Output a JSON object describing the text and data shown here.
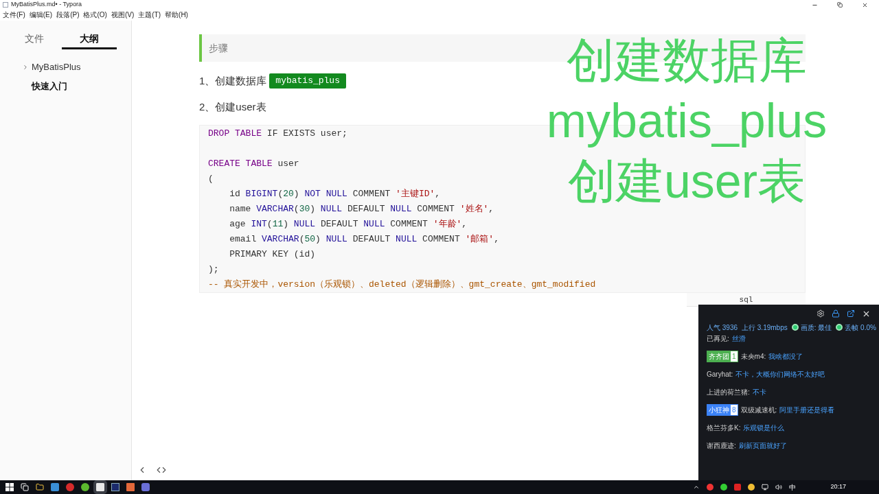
{
  "window": {
    "title": "MyBatisPlus.md• - Typora"
  },
  "menu": [
    "文件(F)",
    "编辑(E)",
    "段落(P)",
    "格式(O)",
    "视图(V)",
    "主题(T)",
    "帮助(H)"
  ],
  "sidebar": {
    "tabs": [
      {
        "label": "文件",
        "selected": false
      },
      {
        "label": "大纲",
        "selected": true
      }
    ],
    "items": [
      {
        "label": "MyBatisPlus",
        "kind": "group",
        "expanded": false,
        "selected": false
      },
      {
        "label": "快速入门",
        "kind": "leaf",
        "selected": true
      }
    ]
  },
  "document": {
    "quote": "步骤",
    "steps": [
      {
        "text": "1、创建数据库",
        "code": "mybatis_plus"
      },
      {
        "text": "2、创建user表"
      }
    ],
    "code_block": {
      "language": "sql",
      "lines": [
        {
          "kind": "code",
          "tokens": [
            {
              "text": "DROP ",
              "kind": "keyword"
            },
            {
              "text": "TABLE",
              "kind": "keyword"
            },
            {
              "text": " IF EXISTS user;",
              "kind": "plain"
            }
          ]
        },
        {
          "kind": "blank"
        },
        {
          "kind": "code",
          "tokens": [
            {
              "text": "CREATE ",
              "kind": "keyword"
            },
            {
              "text": "TABLE",
              "kind": "keyword"
            },
            {
              "text": " user",
              "kind": "plain"
            }
          ]
        },
        {
          "kind": "code",
          "tokens": [
            {
              "text": "(",
              "kind": "plain"
            }
          ]
        },
        {
          "kind": "code",
          "tokens": [
            {
              "text": "    id ",
              "kind": "plain"
            },
            {
              "text": "BIGINT",
              "kind": "builtin"
            },
            {
              "text": "(",
              "kind": "plain"
            },
            {
              "text": "20",
              "kind": "number"
            },
            {
              "text": ") ",
              "kind": "plain"
            },
            {
              "text": "NOT NULL",
              "kind": "builtin"
            },
            {
              "text": " COMMENT ",
              "kind": "plain"
            },
            {
              "text": "'主键ID'",
              "kind": "string"
            },
            {
              "text": ",",
              "kind": "plain"
            }
          ]
        },
        {
          "kind": "code",
          "tokens": [
            {
              "text": "    name ",
              "kind": "plain"
            },
            {
              "text": "VARCHAR",
              "kind": "builtin"
            },
            {
              "text": "(",
              "kind": "plain"
            },
            {
              "text": "30",
              "kind": "number"
            },
            {
              "text": ") ",
              "kind": "plain"
            },
            {
              "text": "NULL",
              "kind": "builtin"
            },
            {
              "text": " DEFAULT ",
              "kind": "plain"
            },
            {
              "text": "NULL",
              "kind": "builtin"
            },
            {
              "text": " COMMENT ",
              "kind": "plain"
            },
            {
              "text": "'姓名'",
              "kind": "string"
            },
            {
              "text": ",",
              "kind": "plain"
            }
          ]
        },
        {
          "kind": "code",
          "tokens": [
            {
              "text": "    age ",
              "kind": "plain"
            },
            {
              "text": "INT",
              "kind": "builtin"
            },
            {
              "text": "(",
              "kind": "plain"
            },
            {
              "text": "11",
              "kind": "number"
            },
            {
              "text": ") ",
              "kind": "plain"
            },
            {
              "text": "NULL",
              "kind": "builtin"
            },
            {
              "text": " DEFAULT ",
              "kind": "plain"
            },
            {
              "text": "NULL",
              "kind": "builtin"
            },
            {
              "text": " COMMENT ",
              "kind": "plain"
            },
            {
              "text": "'年龄'",
              "kind": "string"
            },
            {
              "text": ",",
              "kind": "plain"
            }
          ]
        },
        {
          "kind": "code",
          "tokens": [
            {
              "text": "    email ",
              "kind": "plain"
            },
            {
              "text": "VARCHAR",
              "kind": "builtin"
            },
            {
              "text": "(",
              "kind": "plain"
            },
            {
              "text": "50",
              "kind": "number"
            },
            {
              "text": ") ",
              "kind": "plain"
            },
            {
              "text": "NULL",
              "kind": "builtin"
            },
            {
              "text": " DEFAULT ",
              "kind": "plain"
            },
            {
              "text": "NULL",
              "kind": "builtin"
            },
            {
              "text": " COMMENT ",
              "kind": "plain"
            },
            {
              "text": "'邮箱'",
              "kind": "string"
            },
            {
              "text": ",",
              "kind": "plain"
            }
          ]
        },
        {
          "kind": "code",
          "tokens": [
            {
              "text": "    PRIMARY KEY (id)",
              "kind": "plain"
            }
          ]
        },
        {
          "kind": "code",
          "tokens": [
            {
              "text": ");",
              "kind": "plain"
            }
          ]
        },
        {
          "kind": "code",
          "tokens": [
            {
              "text": "-- 真实开发中，version（乐观锁）、deleted（逻辑删除）、gmt_create、gmt_modified",
              "kind": "comment"
            }
          ]
        }
      ]
    }
  },
  "caption": [
    "创建数据库",
    "mybatis_plus",
    "创建user表"
  ],
  "live_panel": {
    "stats": [
      {
        "kind": "text",
        "label": "人气",
        "value": "3936"
      },
      {
        "kind": "text",
        "label": "上行",
        "value": "3.19mbps"
      },
      {
        "kind": "dot",
        "label": "画质:",
        "value": "最佳"
      },
      {
        "kind": "dot",
        "label": "丢帧",
        "value": "0.0%"
      }
    ],
    "messages": [
      {
        "user": "已再见:",
        "text": "丝滑"
      },
      {
        "badge": {
          "label": "齐齐团",
          "level": "1",
          "color": "#4caf50"
        },
        "user": "未央m4:",
        "text": "我啥都没了"
      },
      {
        "user": "Garyhat:",
        "text": "不卡，大概你们网络不太好吧"
      },
      {
        "user": "上进的荷兰猪:",
        "text": "不卡"
      },
      {
        "badge": {
          "label": "小狂神",
          "level": "8",
          "color": "#3b82f6"
        },
        "user": "双级减速机:",
        "text": "阿里手册还是得看"
      },
      {
        "user": "格兰芬多K:",
        "text": "乐观锁是什么"
      },
      {
        "user": "谢西鹿迹:",
        "text": "刷新页面就好了"
      }
    ]
  },
  "taskbar": {
    "ime": "中",
    "clock": "20:17"
  }
}
